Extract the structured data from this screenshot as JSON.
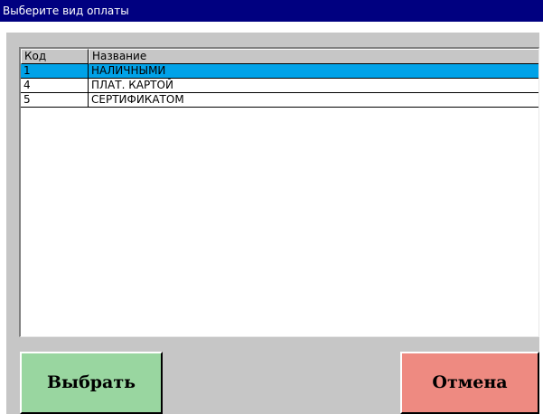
{
  "window": {
    "title": "Выберите вид оплаты"
  },
  "list": {
    "columns": [
      "Код",
      "Название"
    ],
    "rows": [
      {
        "code": "1",
        "name": "НАЛИЧНЫМИ",
        "selected": true
      },
      {
        "code": "4",
        "name": "ПЛАТ. КАРТОЙ",
        "selected": false
      },
      {
        "code": "5",
        "name": "СЕРТИФИКАТОМ",
        "selected": false
      }
    ]
  },
  "buttons": {
    "select_label": "Выбрать",
    "cancel_label": "Отмена"
  },
  "colors": {
    "titlebar": "#000080",
    "selection": "#00a2e8",
    "select_button": "#99d6a0",
    "cancel_button": "#ee8a81"
  }
}
